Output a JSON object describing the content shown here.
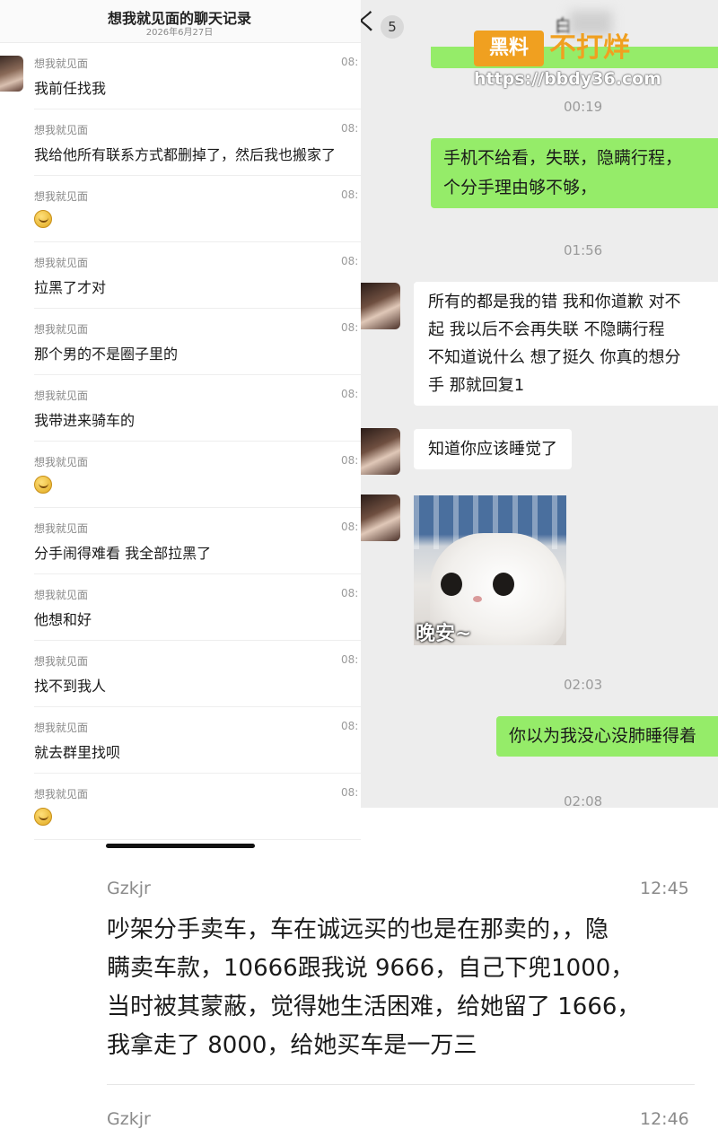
{
  "left_panel": {
    "title": "想我就见面的聊天记录",
    "date": "2026年6月27日",
    "records": [
      {
        "sender": "想我就见面",
        "time": "08:",
        "text": "我前任找我",
        "emoji": false
      },
      {
        "sender": "想我就见面",
        "time": "08:",
        "text": "我给他所有联系方式都删掉了，然后我也搬家了",
        "emoji": false
      },
      {
        "sender": "想我就见面",
        "time": "08:",
        "text": "",
        "emoji": true
      },
      {
        "sender": "想我就见面",
        "time": "08:",
        "text": "拉黑了才对",
        "emoji": false
      },
      {
        "sender": "想我就见面",
        "time": "08:",
        "text": "那个男的不是圈子里的",
        "emoji": false
      },
      {
        "sender": "想我就见面",
        "time": "08:",
        "text": "我带进来骑车的",
        "emoji": false
      },
      {
        "sender": "想我就见面",
        "time": "08:",
        "text": "",
        "emoji": true
      },
      {
        "sender": "想我就见面",
        "time": "08:",
        "text": "分手闹得难看 我全部拉黑了",
        "emoji": false
      },
      {
        "sender": "想我就见面",
        "time": "08:",
        "text": "他想和好",
        "emoji": false
      },
      {
        "sender": "想我就见面",
        "time": "08:",
        "text": "找不到我人",
        "emoji": false
      },
      {
        "sender": "想我就见面",
        "time": "08:",
        "text": "就去群里找呗",
        "emoji": false
      },
      {
        "sender": "想我就见面",
        "time": "08:",
        "text": "",
        "emoji": true
      }
    ]
  },
  "right_panel": {
    "back_label": "く",
    "unread_count": "5",
    "contact_name": "白",
    "timestamps": [
      "00:19",
      "01:56",
      "02:03",
      "02:08"
    ],
    "me_msg_1_line1": "手机不给看，失联，隐瞒行程，",
    "me_msg_1_line2": "个分手理由够不够，",
    "them_msg_1_lines": [
      "所有的都是我的错 我和你道歉 对不",
      "起 我以后不会再失联 不隐瞒行程",
      "不知道说什么 想了挺久 你真的想分",
      "手 那就回复1"
    ],
    "them_msg_2": "知道你应该睡觉了",
    "sticker_caption": "晚安~",
    "me_msg_2": "你以为我没心没肺睡得着"
  },
  "watermark": {
    "badge": "黑料",
    "text": "不打烊",
    "url": "https://bbdy36.com"
  },
  "comments": [
    {
      "user": "Gzkjr",
      "time": "12:45",
      "lines": [
        "吵架分手卖车，车在诚远买的也是在那卖的，，隐",
        "瞒卖车款，10666跟我说 9666，自己下兜1000，",
        "当时被其蒙蔽，觉得她生活困难，给她留了 1666，",
        "我拿走了 8000，给她买车是一万三"
      ]
    },
    {
      "user": "Gzkjr",
      "time": "12:46"
    }
  ],
  "colors": {
    "my_bubble": "#95ec69",
    "their_bubble": "#ffffff",
    "chat_bg": "#ededed",
    "watermark": "#f0a020"
  }
}
